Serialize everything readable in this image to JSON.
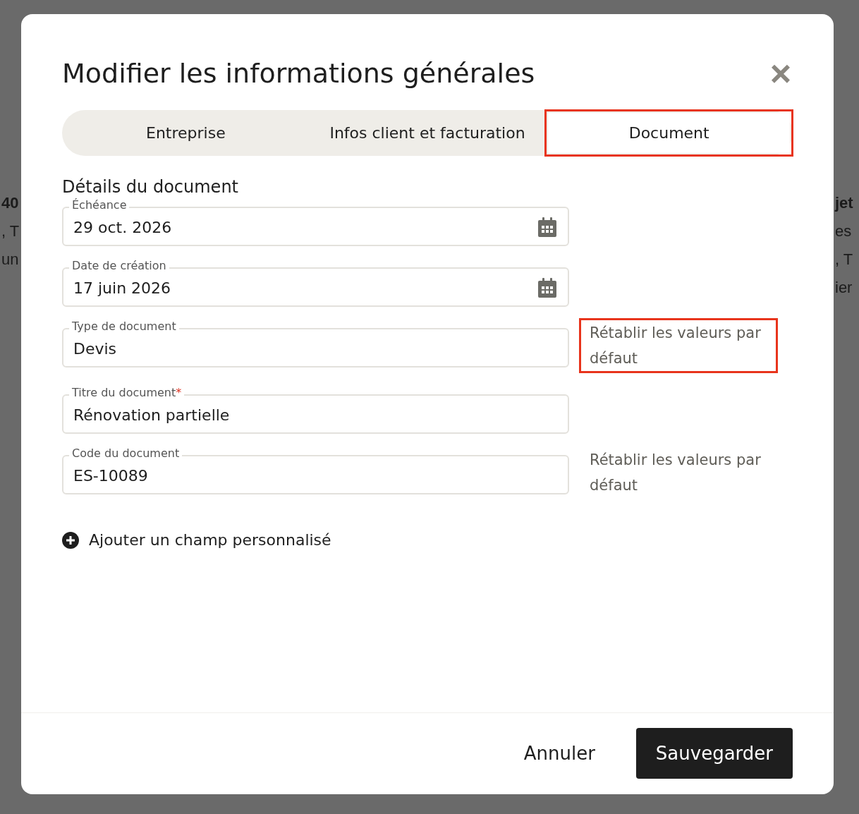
{
  "background_page": {
    "left_fragments": [
      {
        "text": "40",
        "bold": true
      },
      {
        "text": ", T",
        "bold": false
      },
      {
        "text": "un",
        "bold": false
      }
    ],
    "right_fragments": [
      {
        "text": "jet",
        "bold": true
      },
      {
        "text": "es",
        "bold": false
      },
      {
        "text": ", T",
        "bold": false
      },
      {
        "text": "ier",
        "bold": false
      }
    ]
  },
  "dialog": {
    "title": "Modifier les informations générales",
    "close": "×",
    "tabs": [
      {
        "label": "Entreprise",
        "selected": false,
        "highlighted": false
      },
      {
        "label": "Infos client et facturation",
        "selected": false,
        "highlighted": false
      },
      {
        "label": "Document",
        "selected": true,
        "highlighted": true
      }
    ],
    "section_title": "Détails du document",
    "fields": [
      {
        "label": "Échéance",
        "value": "29 oct. 2026",
        "kind": "date"
      },
      {
        "label": "Date de création",
        "value": "17 juin 2026",
        "kind": "date"
      },
      {
        "label": "Type de document",
        "value": "Devis",
        "kind": "text",
        "reset_link": {
          "text": "Rétablir les valeurs par défaut",
          "highlighted": true
        }
      },
      {
        "label": "Titre du document",
        "value": "Rénovation partielle",
        "kind": "text",
        "required_marker": "*"
      },
      {
        "label": "Code du document",
        "value": "ES-10089",
        "kind": "text",
        "reset_link": {
          "text": "Rétablir les valeurs par défaut",
          "highlighted": false
        }
      }
    ],
    "add_field": "Ajouter un champ personnalisé",
    "buttons": {
      "cancel": "Annuler",
      "save": "Sauvegarder"
    }
  }
}
